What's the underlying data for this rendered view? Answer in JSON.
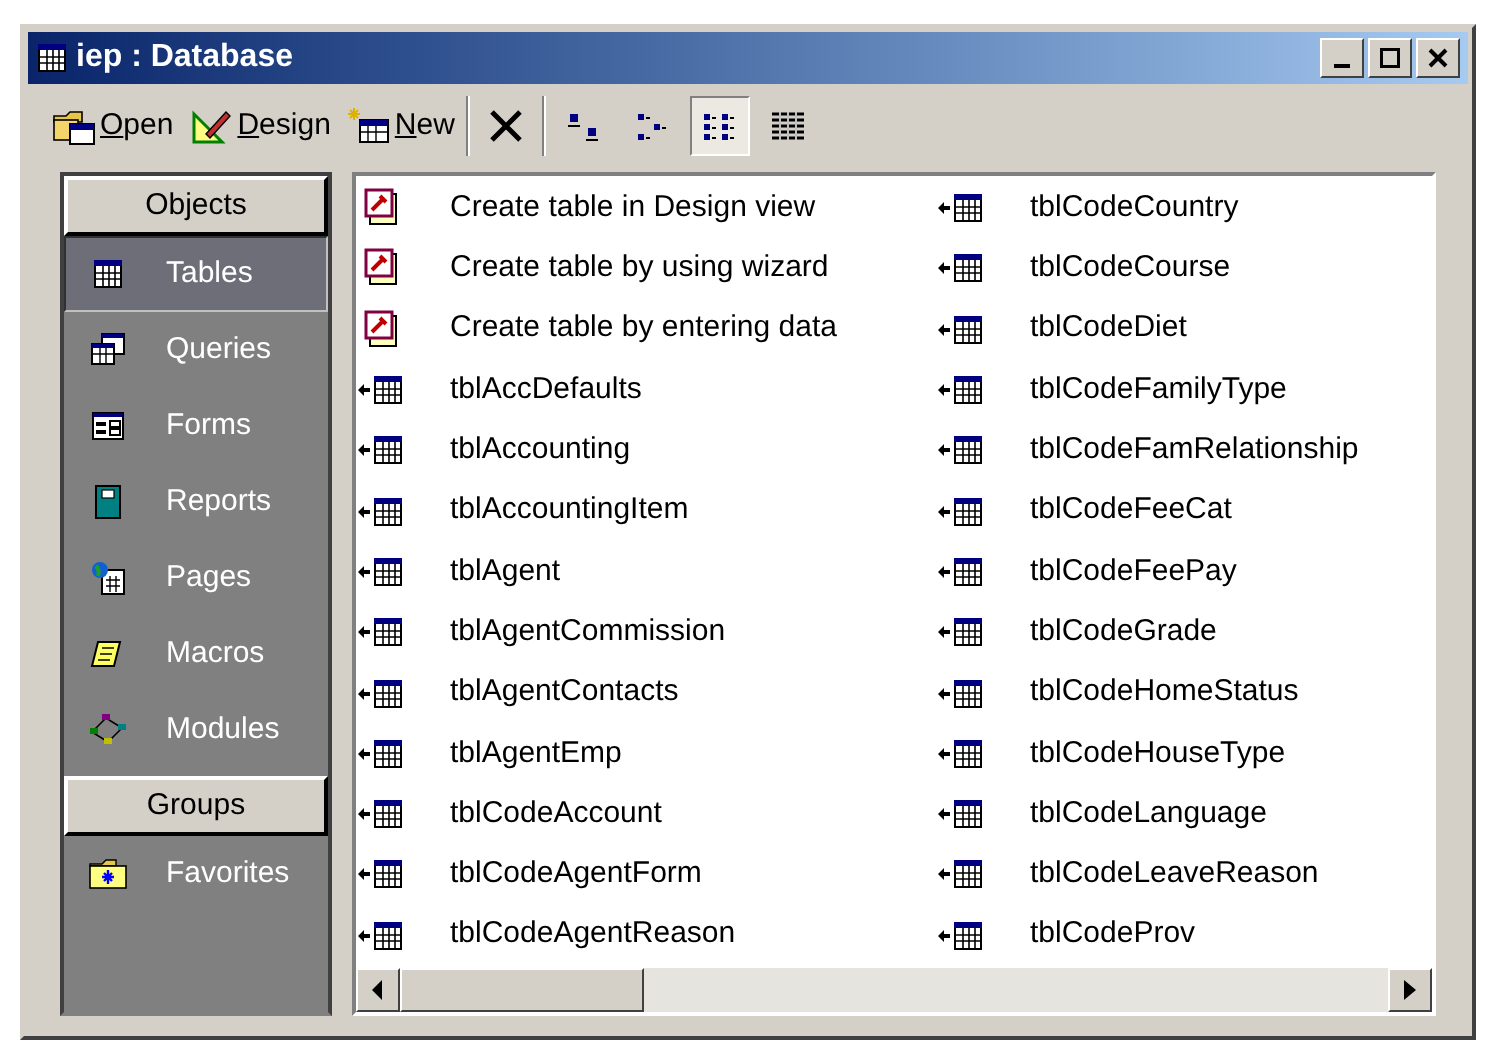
{
  "window": {
    "title": "iep : Database"
  },
  "toolbar": [
    {
      "kind": "open",
      "label": "Open"
    },
    {
      "kind": "design",
      "label": "Design"
    },
    {
      "kind": "new",
      "label": "New"
    },
    {
      "kind": "delete"
    }
  ],
  "view_buttons": [
    {
      "kind": "large",
      "selected": false
    },
    {
      "kind": "small",
      "selected": false
    },
    {
      "kind": "list",
      "selected": true
    },
    {
      "kind": "details",
      "selected": false
    }
  ],
  "sidebar": {
    "sections": [
      {
        "header": "Objects",
        "items": [
          {
            "kind": "tables",
            "label": "Tables",
            "selected": true
          },
          {
            "kind": "queries",
            "label": "Queries",
            "selected": false
          },
          {
            "kind": "forms",
            "label": "Forms",
            "selected": false
          },
          {
            "kind": "reports",
            "label": "Reports",
            "selected": false
          },
          {
            "kind": "pages",
            "label": "Pages",
            "selected": false
          },
          {
            "kind": "macros",
            "label": "Macros",
            "selected": false
          },
          {
            "kind": "modules",
            "label": "Modules",
            "selected": false
          }
        ]
      },
      {
        "header": "Groups",
        "items": [
          {
            "kind": "favorites",
            "label": "Favorites",
            "selected": false
          }
        ]
      }
    ]
  },
  "items": [
    {
      "kind": "shortcut",
      "label": "Create table in Design view"
    },
    {
      "kind": "shortcut",
      "label": "Create table by using wizard"
    },
    {
      "kind": "shortcut",
      "label": "Create table by entering data"
    },
    {
      "kind": "table",
      "label": "tblAccDefaults"
    },
    {
      "kind": "table",
      "label": "tblAccounting"
    },
    {
      "kind": "table",
      "label": "tblAccountingItem"
    },
    {
      "kind": "table",
      "label": "tblAgent"
    },
    {
      "kind": "table",
      "label": "tblAgentCommission"
    },
    {
      "kind": "table",
      "label": "tblAgentContacts"
    },
    {
      "kind": "table",
      "label": "tblAgentEmp"
    },
    {
      "kind": "table",
      "label": "tblCodeAccount"
    },
    {
      "kind": "table",
      "label": "tblCodeAgentForm"
    },
    {
      "kind": "table",
      "label": "tblCodeAgentReason"
    },
    {
      "kind": "table",
      "label": "tblCodeCountry"
    },
    {
      "kind": "table",
      "label": "tblCodeCourse"
    },
    {
      "kind": "table",
      "label": "tblCodeDiet"
    },
    {
      "kind": "table",
      "label": "tblCodeFamilyType"
    },
    {
      "kind": "table",
      "label": "tblCodeFamRelationship"
    },
    {
      "kind": "table",
      "label": "tblCodeFeeCat"
    },
    {
      "kind": "table",
      "label": "tblCodeFeePay"
    },
    {
      "kind": "table",
      "label": "tblCodeGrade"
    },
    {
      "kind": "table",
      "label": "tblCodeHomeStatus"
    },
    {
      "kind": "table",
      "label": "tblCodeHouseType"
    },
    {
      "kind": "table",
      "label": "tblCodeLanguage"
    },
    {
      "kind": "table",
      "label": "tblCodeLeaveReason"
    },
    {
      "kind": "table",
      "label": "tblCodeProv"
    }
  ]
}
